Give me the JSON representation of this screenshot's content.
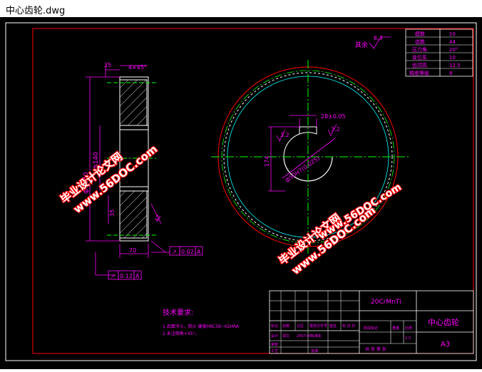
{
  "window": {
    "title": "中心齿轮.dwg"
  },
  "colors": {
    "background": "#000000",
    "frame": "#ffffff",
    "border_red": "#ff0000",
    "dim_magenta": "#ff00ff",
    "center_green": "#00ff00",
    "hatch_grey": "#cfcfcf",
    "cyan": "#00ffff",
    "watermark_red": "#ff0000",
    "watermark_white": "#ffffff"
  },
  "drawing": {
    "roughness": {
      "label": "其余",
      "value": "6.3"
    },
    "side_view": {
      "top_chamfer": "4×45°",
      "top_dim": "35",
      "left_dim_outer": "ф1640",
      "left_dim_inner": "ф140",
      "mid_dim": "35",
      "right_small": "42",
      "width_dim": "70",
      "tol_1": {
        "symbol": "↗",
        "value": "0.02",
        "datum": "A"
      },
      "tol_2": {
        "symbol": "↗",
        "value": "0.12",
        "datum": "A"
      }
    },
    "front_view": {
      "keyway_width": "28±0.05",
      "ra_top": "3.2",
      "ra_left": "3.2",
      "height_dim": "174",
      "bore_dim": "ф50H7(0.025)"
    },
    "param_table": [
      {
        "label": "模数",
        "value": "10"
      },
      {
        "label": "齿数",
        "value": "44"
      },
      {
        "label": "压力角",
        "value": "20°"
      },
      {
        "label": "变位系",
        "value": "10"
      },
      {
        "label": "齿顶高",
        "value": "12.5"
      },
      {
        "label": "精度等级",
        "value": "8"
      }
    ],
    "tech_req": {
      "heading": "技术要求:",
      "items": [
        "1.齿面淬火，回火 硬度HRC58~62HRA",
        "2.未注倒角×45°。"
      ]
    },
    "title_block": {
      "material": "20CrMnTi",
      "part_name": "中心齿轮",
      "paper_size": "A3",
      "scale_label": "比例",
      "scale_value": "1:3",
      "weight_label": "重量",
      "stage_label": "阶段标记",
      "sheet_label": "共 张 第 张",
      "header_cells": [
        "标记",
        "处数",
        "分区",
        "更改文件号",
        "签名",
        "年.月.日"
      ],
      "row_design": [
        "设计",
        "郑文",
        "2007.05",
        "标准化"
      ],
      "row_check": "审核",
      "row_craft": "工艺",
      "row_approve": "批准"
    },
    "watermarks": [
      {
        "line1": "毕业设计论文网",
        "line2": "www.56DOC.com"
      },
      {
        "line1": "毕业设计论文网",
        "line2": "www.56DOC.com"
      },
      {
        "line1": "毕业设计论文网",
        "line2": "www.56DOC.com"
      }
    ]
  }
}
